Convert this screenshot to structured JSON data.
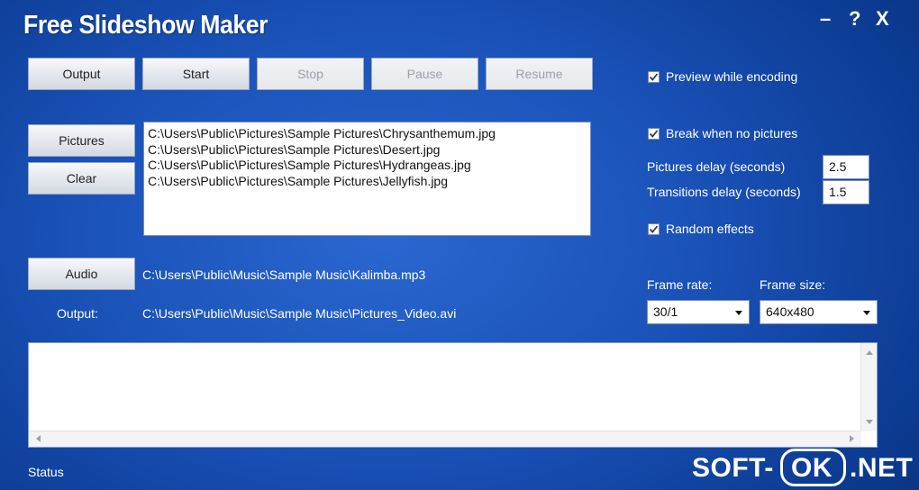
{
  "app": {
    "title": "Free Slideshow Maker"
  },
  "window_controls": {
    "minimize": "–",
    "help": "?",
    "close": "X"
  },
  "toolbar": {
    "output": "Output",
    "start": "Start",
    "stop": "Stop",
    "pause": "Pause",
    "resume": "Resume"
  },
  "pictures": {
    "button": "Pictures",
    "clear_button": "Clear",
    "files": [
      "C:\\Users\\Public\\Pictures\\Sample Pictures\\Chrysanthemum.jpg",
      "C:\\Users\\Public\\Pictures\\Sample Pictures\\Desert.jpg",
      "C:\\Users\\Public\\Pictures\\Sample Pictures\\Hydrangeas.jpg",
      "C:\\Users\\Public\\Pictures\\Sample Pictures\\Jellyfish.jpg"
    ]
  },
  "audio": {
    "button": "Audio",
    "path": "C:\\Users\\Public\\Music\\Sample Music\\Kalimba.mp3"
  },
  "output": {
    "label": "Output:",
    "path": "C:\\Users\\Public\\Music\\Sample Music\\Pictures_Video.avi"
  },
  "options": {
    "preview_while_encoding": {
      "label": "Preview while encoding",
      "checked": true
    },
    "break_when_no_pictures": {
      "label": "Break when no pictures",
      "checked": true
    },
    "pictures_delay": {
      "label": "Pictures delay (seconds)",
      "value": "2.5"
    },
    "transitions_delay": {
      "label": "Transitions delay (seconds)",
      "value": "1.5"
    },
    "random_effects": {
      "label": "Random effects",
      "checked": true
    },
    "frame_rate": {
      "label": "Frame rate:",
      "value": "30/1"
    },
    "frame_size": {
      "label": "Frame size:",
      "value": "640x480"
    }
  },
  "status": {
    "label": "Status"
  },
  "watermark": {
    "left": "SOFT-",
    "middle": "OK",
    "right": ".NET"
  }
}
